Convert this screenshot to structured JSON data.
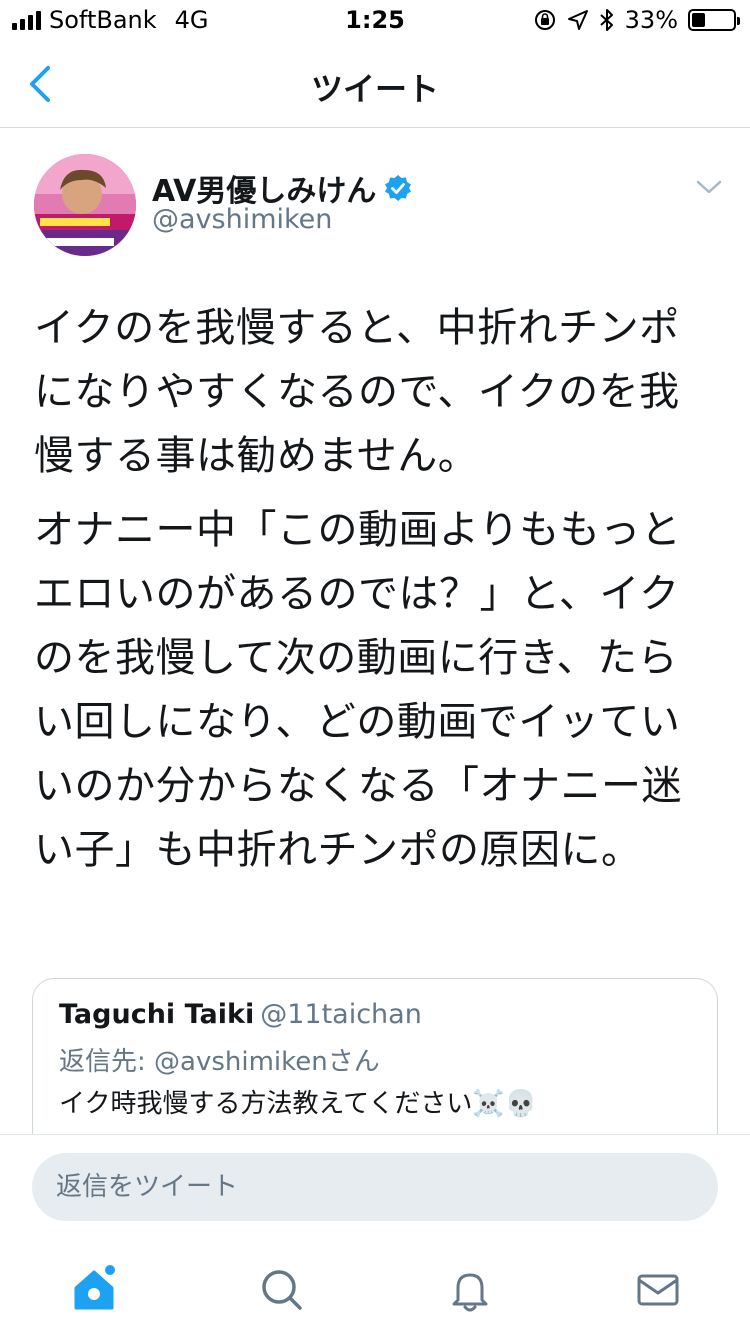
{
  "status_bar": {
    "carrier": "SoftBank",
    "network": "4G",
    "time": "1:25",
    "battery": "33%",
    "battery_level": 0.33
  },
  "nav": {
    "title": "ツイート"
  },
  "tweet": {
    "author_name": "AV男優しみけん",
    "handle": "@avshimiken",
    "paragraphs": [
      "イクのを我慢すると、中折れチンポになりやすくなるので、イクのを我慢する事は勧めません。",
      "オナニー中「この動画よりももっとエロいのがあるのでは？」と、イクのを我慢して次の動画に行き、たらい回しになり、どの動画でイッていいのか分からなくなる「オナニー迷い子」も中折れチンポの原因に。"
    ]
  },
  "quoted_tweet": {
    "author_name": "Taguchi Taiki",
    "handle": "@11taichan",
    "reply_to": "返信先: @avshimikenさん",
    "text": "イク時我慢する方法教えてください☠️💀"
  },
  "reply": {
    "placeholder": "返信をツイート"
  },
  "colors": {
    "accent": "#1da1f2",
    "muted": "#657786",
    "text": "#14171a",
    "input_bg": "#e6ecf0"
  },
  "icons": {
    "back": "chevron-left-icon",
    "verified": "verified-badge-icon",
    "more": "chevron-down-icon",
    "home": "home-icon",
    "search": "search-icon",
    "notifications": "bell-icon",
    "messages": "mail-icon"
  }
}
